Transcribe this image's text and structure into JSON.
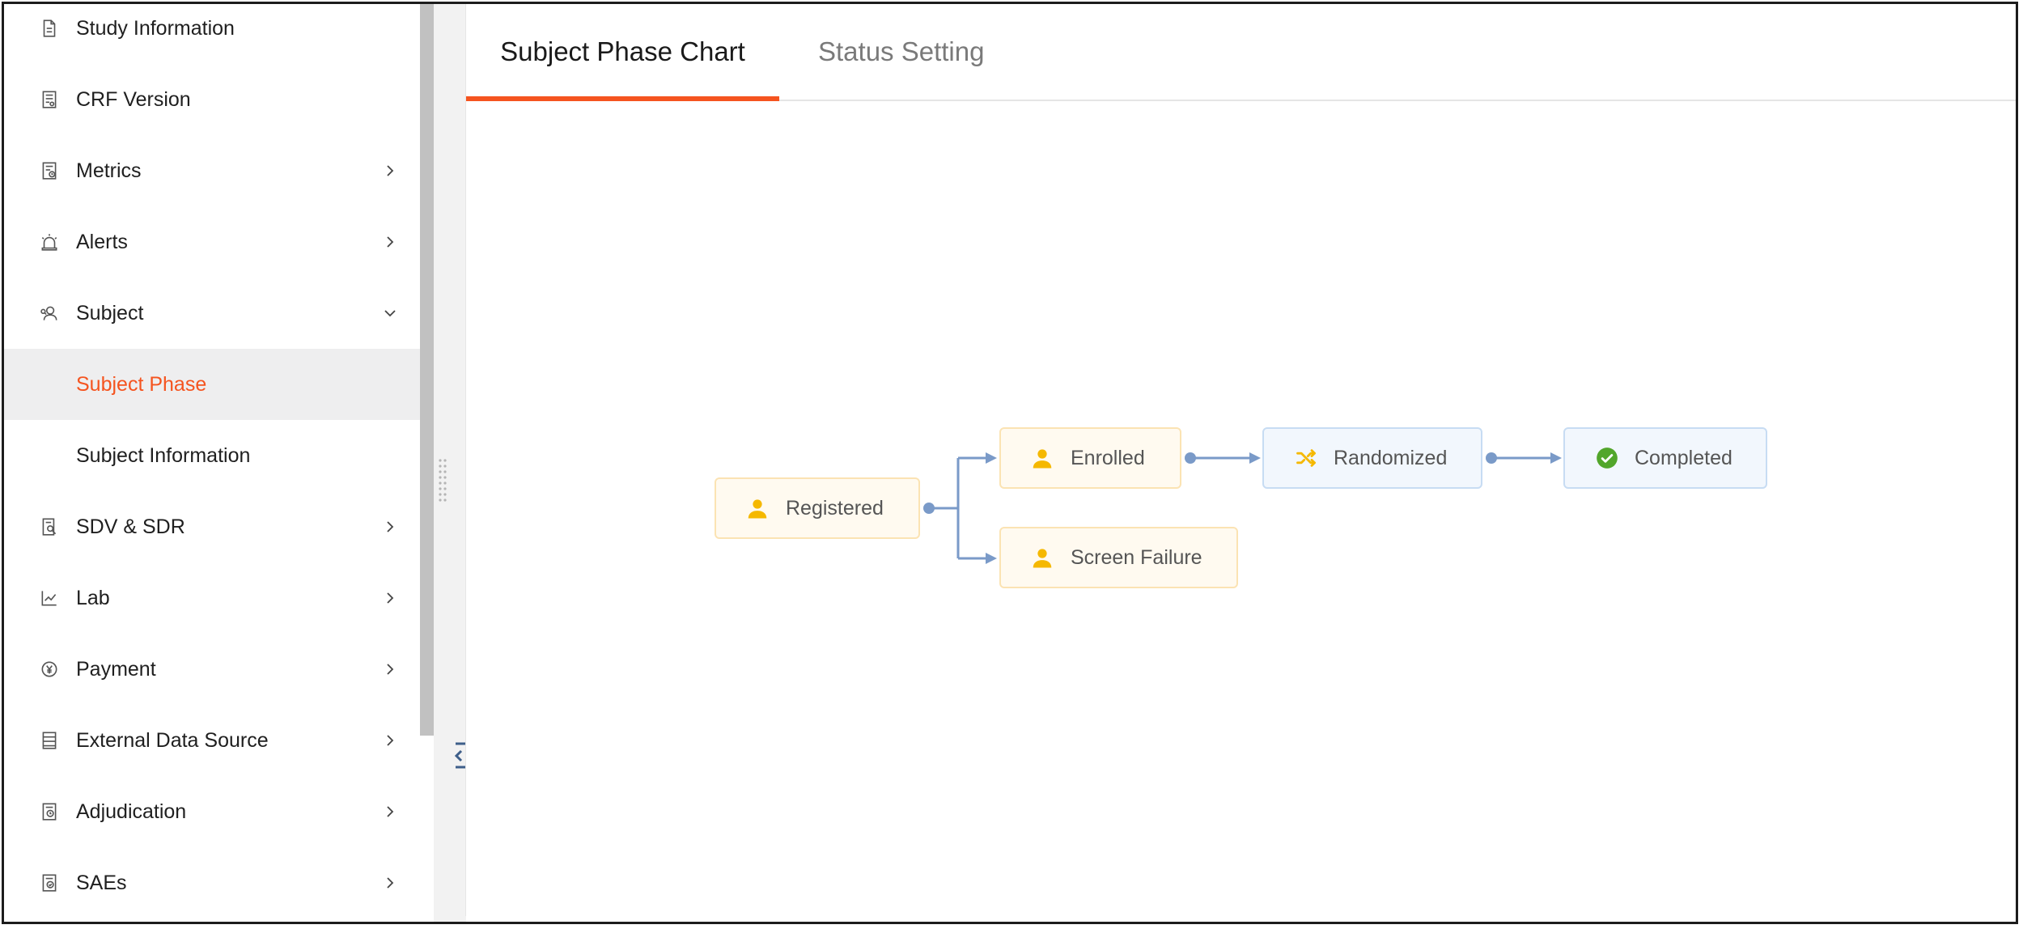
{
  "sidebar": {
    "items": [
      {
        "label": "Study Information",
        "icon": "document-icon",
        "has_chevron": false
      },
      {
        "label": "CRF Version",
        "icon": "form-version-icon",
        "has_chevron": false
      },
      {
        "label": "Metrics",
        "icon": "metrics-report-icon",
        "has_chevron": true,
        "chevron": "right"
      },
      {
        "label": "Alerts",
        "icon": "alarm-siren-icon",
        "has_chevron": true,
        "chevron": "right"
      },
      {
        "label": "Subject",
        "icon": "user-search-icon",
        "has_chevron": true,
        "chevron": "down"
      },
      {
        "label": "Subject Phase",
        "active": true
      },
      {
        "label": "Subject Information"
      },
      {
        "label": "SDV & SDR",
        "icon": "document-search-icon",
        "has_chevron": true,
        "chevron": "right"
      },
      {
        "label": "Lab",
        "icon": "line-chart-icon",
        "has_chevron": true,
        "chevron": "right"
      },
      {
        "label": "Payment",
        "icon": "yen-coin-icon",
        "has_chevron": true,
        "chevron": "right"
      },
      {
        "label": "External Data Source",
        "icon": "database-list-icon",
        "has_chevron": true,
        "chevron": "right"
      },
      {
        "label": "Adjudication",
        "icon": "document-clock-icon",
        "has_chevron": true,
        "chevron": "right"
      },
      {
        "label": "SAEs",
        "icon": "document-check-icon",
        "has_chevron": true,
        "chevron": "right"
      }
    ]
  },
  "tabs": {
    "active": "Subject Phase Chart",
    "inactive": "Status Setting"
  },
  "phases": {
    "registered": "Registered",
    "enrolled": "Enrolled",
    "screen_failure": "Screen Failure",
    "randomized": "Randomized",
    "completed": "Completed"
  },
  "colors": {
    "accent": "#f5541f",
    "person_icon": "#f5b800",
    "check_icon": "#52a62b",
    "edge": "#7a9ac8"
  }
}
